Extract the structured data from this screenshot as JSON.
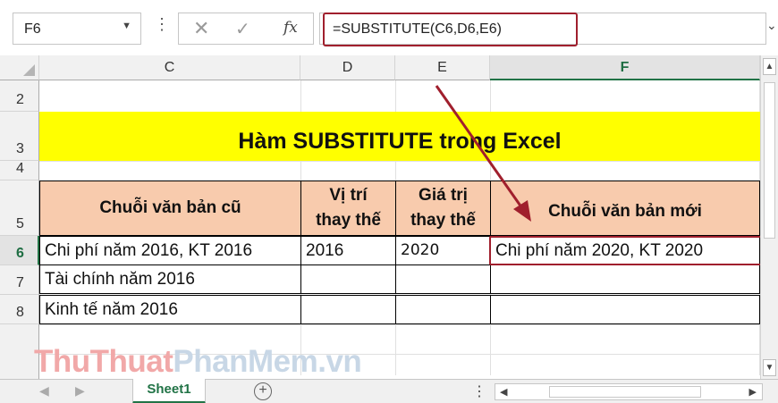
{
  "formula_bar": {
    "name_box": "F6",
    "cancel_glyph": "✕",
    "enter_glyph": "✓",
    "fx_label": "fx",
    "formula": "=SUBSTITUTE(C6,D6,E6)"
  },
  "columns": [
    "C",
    "D",
    "E",
    "F"
  ],
  "rows": [
    "2",
    "3",
    "4",
    "5",
    "6",
    "7",
    "8"
  ],
  "sheet": {
    "title": "Hàm SUBSTITUTE trong Excel",
    "headers": {
      "c": "Chuỗi văn bản cũ",
      "d_line1": "Vị trí",
      "d_line2": "thay thế",
      "e_line1": "Giá trị",
      "e_line2": "thay thế",
      "f": "Chuỗi văn bản mới"
    },
    "data": [
      {
        "c": "Chi phí năm 2016, KT 2016",
        "d": "2016",
        "e": "2020",
        "f": "Chi phí năm 2020, KT 2020"
      },
      {
        "c": "Tài chính năm 2016",
        "d": "",
        "e": "",
        "f": ""
      },
      {
        "c": "Kinh tế năm 2016",
        "d": "",
        "e": "",
        "f": ""
      }
    ]
  },
  "watermark": {
    "part1": "ThuThuat",
    "part2": "PhanMem.vn"
  },
  "tabs": {
    "active": "Sheet1",
    "add": "+"
  },
  "colors": {
    "title_fill": "#ffff00",
    "header_fill": "#f8cbad",
    "highlight": "#a01f2d",
    "excel_green": "#217346"
  }
}
